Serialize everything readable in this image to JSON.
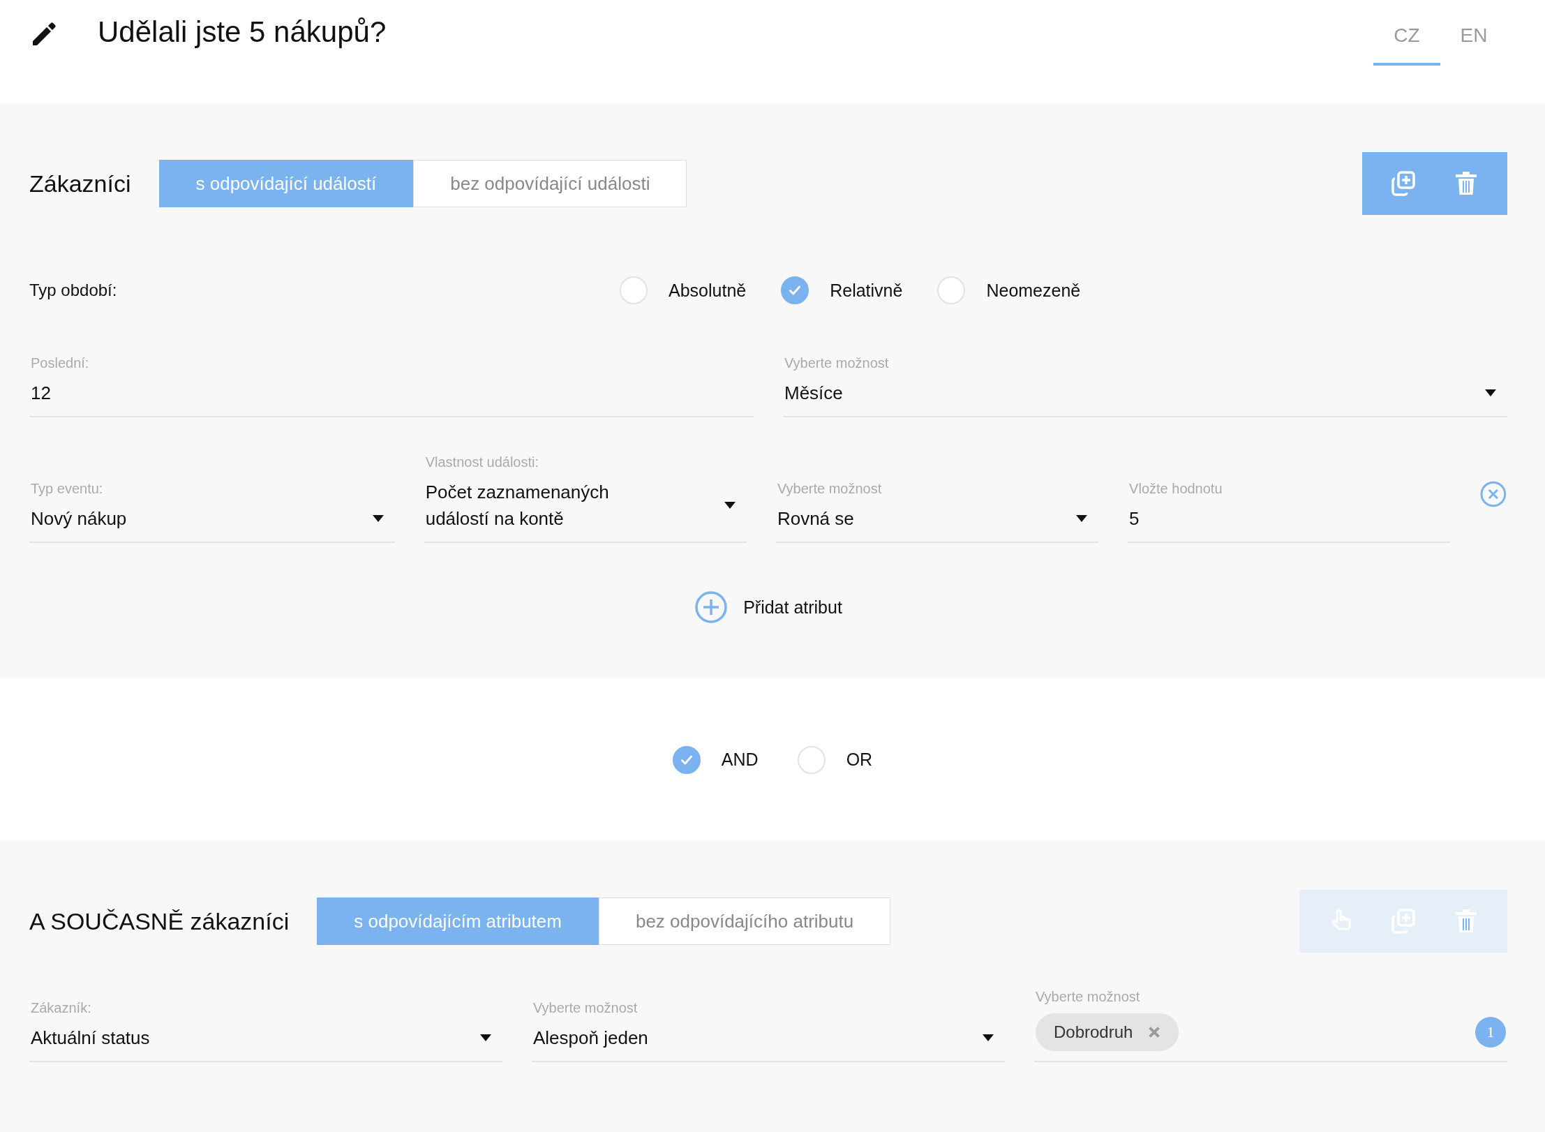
{
  "header": {
    "title": "Udělali jste 5 nákupů?",
    "languages": [
      {
        "label": "CZ",
        "selected": true
      },
      {
        "label": "EN",
        "selected": false
      }
    ]
  },
  "condition_block": {
    "title": "Zákazníci",
    "toggle": [
      {
        "label": "s odpovídající událostí",
        "selected": true
      },
      {
        "label": "bez odpovídající události",
        "selected": false
      }
    ],
    "actions": [
      {
        "kind": "copy"
      },
      {
        "kind": "delete"
      }
    ],
    "actions_disabled": false,
    "period_type": {
      "label": "Typ období:",
      "options": [
        {
          "label": "Absolutně",
          "selected": false
        },
        {
          "label": "Relativně",
          "selected": true
        },
        {
          "label": "Neomezeně",
          "selected": false
        }
      ]
    },
    "period_fields": [
      {
        "kind": "input",
        "label": "Poslední:",
        "value": "12"
      },
      {
        "kind": "select",
        "label": "Vyberte možnost",
        "value": "Měsíce"
      }
    ],
    "event_fields": [
      {
        "kind": "select",
        "label": "Typ eventu:",
        "value": "Nový nákup"
      },
      {
        "kind": "select",
        "label": "Vlastnost události:",
        "value": "Počet zaznamenaných událostí na kontě"
      },
      {
        "kind": "select",
        "label": "Vyberte možnost",
        "value": "Rovná se"
      },
      {
        "kind": "input",
        "label": "Vložte hodnotu",
        "value": "5"
      }
    ],
    "add_attribute": "Přidat atribut"
  },
  "operator": [
    {
      "label": "AND",
      "selected": true
    },
    {
      "label": "OR",
      "selected": false
    }
  ],
  "attribute_block": {
    "title": "A SOUČASNĚ zákazníci",
    "toggle": [
      {
        "label": "s odpovídajícím atributem",
        "selected": true
      },
      {
        "label": "bez odpovídajícího atributu",
        "selected": false
      }
    ],
    "actions": [
      {
        "kind": "drag"
      },
      {
        "kind": "copy"
      },
      {
        "kind": "delete"
      }
    ],
    "actions_disabled": true,
    "fields": [
      {
        "kind": "select",
        "label": "Zákazník:",
        "value": "Aktuální status"
      },
      {
        "kind": "select",
        "label": "Vyberte možnost",
        "value": "Alespoň jeden"
      },
      {
        "kind": "tags",
        "label": "Vyberte možnost",
        "tags": [
          "Dobrodruh"
        ],
        "count": "1"
      }
    ]
  }
}
